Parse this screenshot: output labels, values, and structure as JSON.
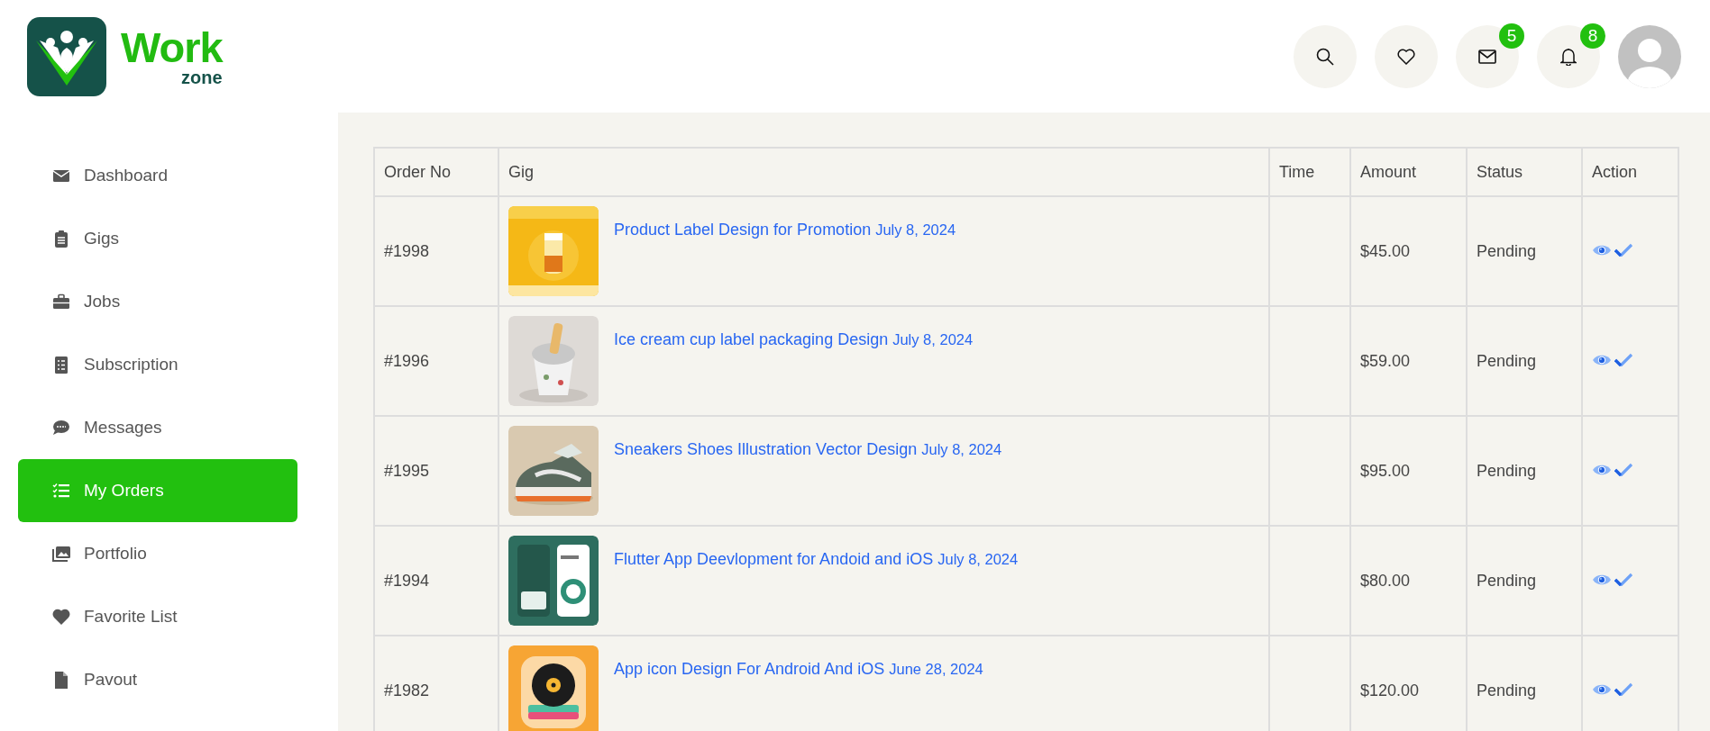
{
  "brand": {
    "name": "Work",
    "tagline": "zone"
  },
  "header_buttons": [
    {
      "kind": "search"
    },
    {
      "kind": "favorites"
    },
    {
      "kind": "messages",
      "badge": "5"
    },
    {
      "kind": "notifications",
      "badge": "8"
    }
  ],
  "sidebar": {
    "items": [
      {
        "label": "Dashboard",
        "selected": false
      },
      {
        "label": "Gigs",
        "selected": false
      },
      {
        "label": "Jobs",
        "selected": false
      },
      {
        "label": "Subscription",
        "selected": false
      },
      {
        "label": "Messages",
        "selected": false
      },
      {
        "label": "My Orders",
        "selected": true
      },
      {
        "label": "Portfolio",
        "selected": false
      },
      {
        "label": "Favorite List",
        "selected": false
      },
      {
        "label": "Pavout",
        "selected": false
      }
    ]
  },
  "table": {
    "columns": [
      "Order No",
      "Gig",
      "Time",
      "Amount",
      "Status",
      "Action"
    ],
    "rows": [
      {
        "order_no": "#1998",
        "gig": "Product Label Design for Promotion",
        "date": "July 8, 2024",
        "amount": "$45.00",
        "status": "Pending"
      },
      {
        "order_no": "#1996",
        "gig": "Ice cream cup label packaging Design",
        "date": "July 8, 2024",
        "amount": "$59.00",
        "status": "Pending"
      },
      {
        "order_no": "#1995",
        "gig": "Sneakers Shoes Illustration Vector Design",
        "date": "July 8, 2024",
        "amount": "$95.00",
        "status": "Pending"
      },
      {
        "order_no": "#1994",
        "gig": "Flutter App Deevlopment for Andoid and iOS",
        "date": "July 8, 2024",
        "amount": "$80.00",
        "status": "Pending"
      },
      {
        "order_no": "#1982",
        "gig": "App icon Design For Android And iOS",
        "date": "June 28, 2024",
        "amount": "$120.00",
        "status": "Pending"
      }
    ]
  }
}
